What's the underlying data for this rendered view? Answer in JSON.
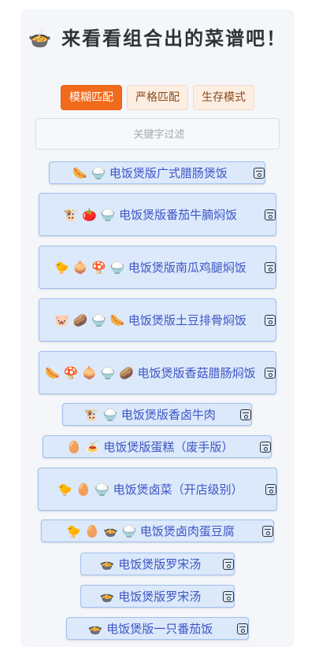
{
  "header": {
    "pot_icon": "🍲",
    "title": "来看看组合出的菜谱吧！"
  },
  "modes": [
    {
      "label": "模糊匹配",
      "active": true
    },
    {
      "label": "严格匹配",
      "active": false
    },
    {
      "label": "生存模式",
      "active": false
    }
  ],
  "filter": {
    "placeholder": "关键字过滤",
    "value": ""
  },
  "recipes": [
    {
      "text": "🌭 🍚 电饭煲版广式腊肠煲饭"
    },
    {
      "text": "🐮 🍅 🍚 电饭煲版番茄牛腩焖饭"
    },
    {
      "text": "🐤 🧅 🍄 🍚 电饭煲版南瓜鸡腿焖饭"
    },
    {
      "text": "🐷 🥔 🍚 🌭 电饭煲版土豆排骨焖饭"
    },
    {
      "text": "🌭 🍄 🧅 🍚 🥔 电饭煲版香菇腊肠焖饭"
    },
    {
      "text": "🐮 🍚 电饭煲版香卤牛肉"
    },
    {
      "text": "🥚 🍝 电饭煲版蛋糕（废手版）"
    },
    {
      "text": "🐤 🥚 🍚 电饭煲卤菜（开店级别）"
    },
    {
      "text": "🐤 🥚 🍲 🍚 电饭煲卤肉蛋豆腐"
    },
    {
      "text": "🍲 电饭煲版罗宋汤"
    },
    {
      "text": "🍲 电饭煲版罗宋汤"
    },
    {
      "text": "🍲 电饭煲版一只番茄饭"
    }
  ]
}
